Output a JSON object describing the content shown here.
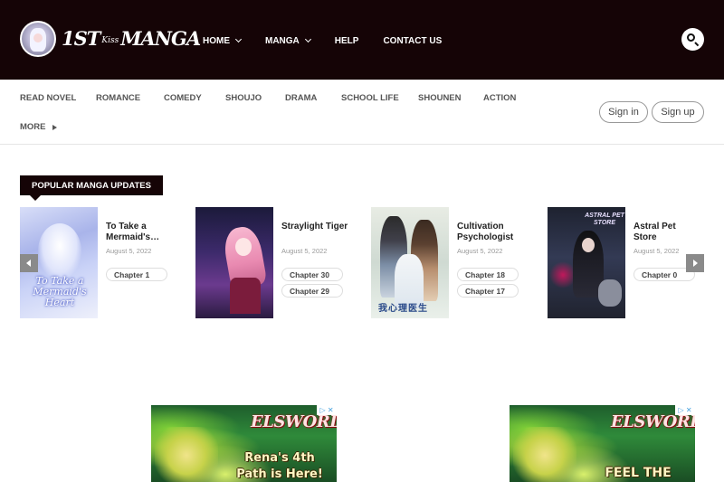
{
  "site": {
    "logo_text_main": "1ST",
    "logo_text_small": "Kiss",
    "logo_text_tail": "MANGA"
  },
  "mainnav": {
    "items": [
      {
        "label": "HOME",
        "dropdown": true
      },
      {
        "label": "MANGA",
        "dropdown": true
      },
      {
        "label": "HELP",
        "dropdown": false
      },
      {
        "label": "CONTACT US",
        "dropdown": false
      }
    ]
  },
  "genres": {
    "items": [
      "READ NOVEL",
      "ROMANCE",
      "COMEDY",
      "SHOUJO",
      "DRAMA",
      "SCHOOL LIFE",
      "SHOUNEN",
      "ACTION"
    ],
    "more_label": "MORE"
  },
  "auth": {
    "sign_in": "Sign in",
    "sign_up": "Sign up"
  },
  "popular": {
    "heading": "POPULAR MANGA UPDATES",
    "cards": [
      {
        "title": "To Take a Mermaid's…",
        "date": "August 5, 2022",
        "cover_text": "To Take a Mermaid's Heart",
        "chapters": [
          "Chapter 1"
        ]
      },
      {
        "title": "Straylight Tiger",
        "date": "August 5, 2022",
        "cover_text": "",
        "chapters": [
          "Chapter 30",
          "Chapter 29"
        ]
      },
      {
        "title": "Cultivation Psychologist",
        "date": "August 5, 2022",
        "cover_text": "我心理医生",
        "chapters": [
          "Chapter 18",
          "Chapter 17"
        ]
      },
      {
        "title": "Astral Pet Store",
        "date": "August 5, 2022",
        "cover_text": "ASTRAL PET STORE",
        "chapters": [
          "Chapter 0"
        ]
      }
    ]
  },
  "ads": [
    {
      "brand": "ELSWORD",
      "tagline": "Rena's 4th Path is Here!",
      "adchoices": "▷ ✕"
    },
    {
      "brand": "ELSWORD",
      "tagline": "FEEL THE",
      "adchoices": "▷ ✕"
    }
  ],
  "colors": {
    "header_bg": "#150406",
    "arrow_bg": "#8a8a8a",
    "ad_green": "#2f8a3a"
  },
  "icons": {
    "search": "search-icon",
    "prev": "chevron-left-icon",
    "next": "chevron-right-icon",
    "more": "triangle-right-icon"
  }
}
